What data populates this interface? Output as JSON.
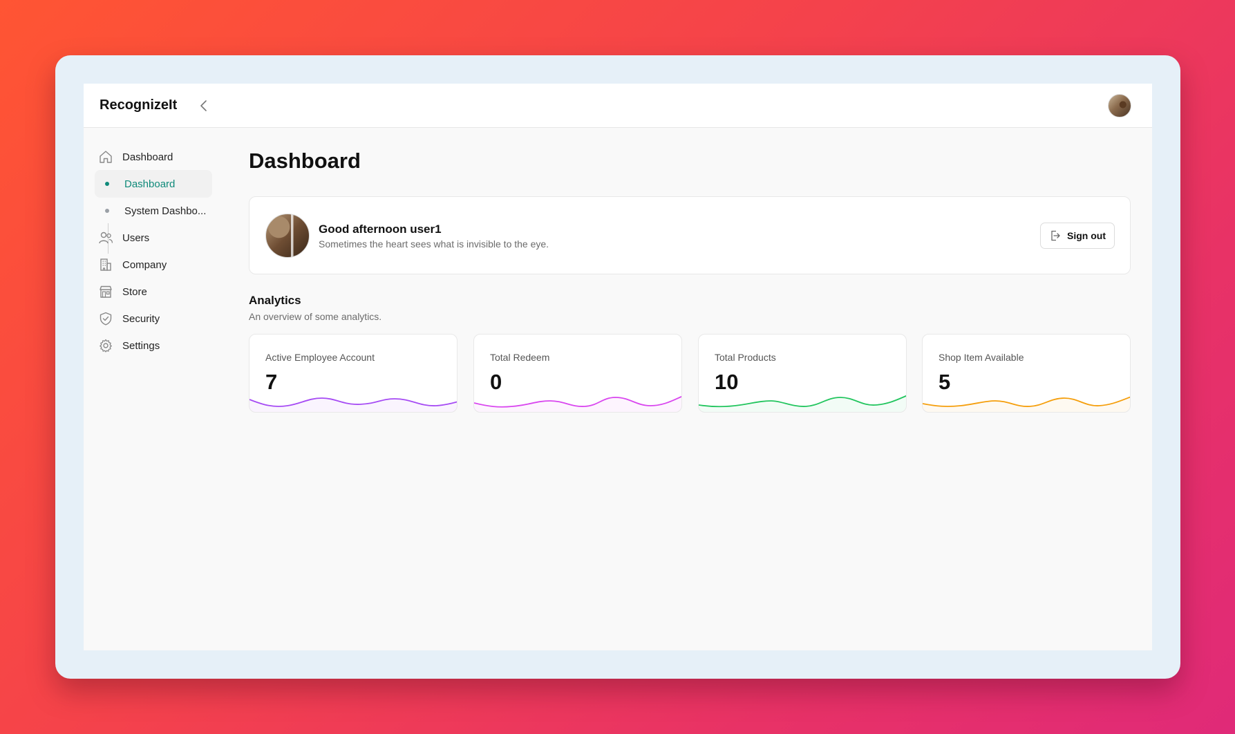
{
  "app": {
    "brand": "RecognizeIt"
  },
  "sidebar": {
    "items": [
      {
        "label": "Dashboard",
        "icon": "home-icon"
      },
      {
        "label": "Dashboard",
        "icon": "dot",
        "sub": true,
        "active": true
      },
      {
        "label": "System Dashbo...",
        "icon": "dot",
        "sub": true
      },
      {
        "label": "Users",
        "icon": "users-icon"
      },
      {
        "label": "Company",
        "icon": "building-icon"
      },
      {
        "label": "Store",
        "icon": "store-icon"
      },
      {
        "label": "Security",
        "icon": "shield-icon"
      },
      {
        "label": "Settings",
        "icon": "gear-icon"
      }
    ]
  },
  "page": {
    "title": "Dashboard"
  },
  "welcome": {
    "greeting": "Good afternoon user1",
    "quote": "Sometimes the heart sees what is invisible to the eye.",
    "signout_label": "Sign out"
  },
  "analytics": {
    "title": "Analytics",
    "subtitle": "An overview of some analytics.",
    "cards": [
      {
        "label": "Active Employee Account",
        "value": "7",
        "color": "#a64bf4"
      },
      {
        "label": "Total Redeem",
        "value": "0",
        "color": "#d946ef"
      },
      {
        "label": "Total Products",
        "value": "10",
        "color": "#22c55e"
      },
      {
        "label": "Shop Item Available",
        "value": "5",
        "color": "#f59e0b"
      }
    ]
  },
  "colors": {
    "accent": "#0f8a7a"
  }
}
